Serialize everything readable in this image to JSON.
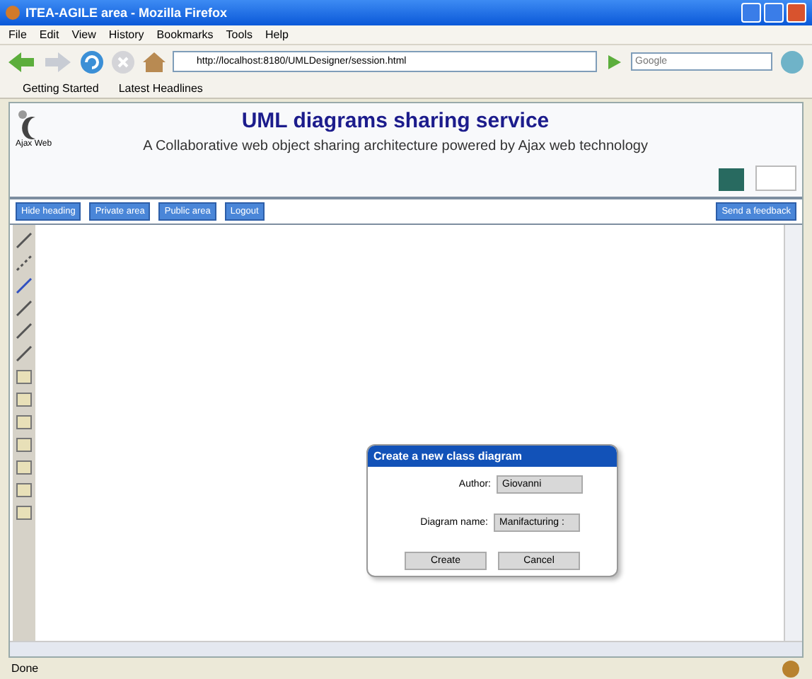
{
  "window": {
    "title": "ITEA-AGILE area - Mozilla Firefox"
  },
  "menu": [
    "File",
    "Edit",
    "View",
    "History",
    "Bookmarks",
    "Tools",
    "Help"
  ],
  "address_bar": {
    "value": "http://localhost:8180/UMLDesigner/session.html"
  },
  "search": {
    "placeholder": "Google"
  },
  "bookmarks": [
    "Getting Started",
    "Latest Headlines"
  ],
  "header": {
    "logo_text": "Ajax Web",
    "title": "UML diagrams sharing service",
    "subtitle": "A Collaborative web object sharing architecture powered by Ajax web technology"
  },
  "nav_buttons": [
    "Hide heading",
    "Private area",
    "Public area",
    "Logout"
  ],
  "feedback_button": "Send a feedback",
  "dialog": {
    "title": "Create a new class diagram",
    "fields": [
      {
        "label": "Author:",
        "value": "Giovanni"
      },
      {
        "label": "Diagram name:",
        "value": "Manifacturing :"
      }
    ],
    "buttons": [
      "Create",
      "Cancel"
    ]
  },
  "status_bar": "Done"
}
